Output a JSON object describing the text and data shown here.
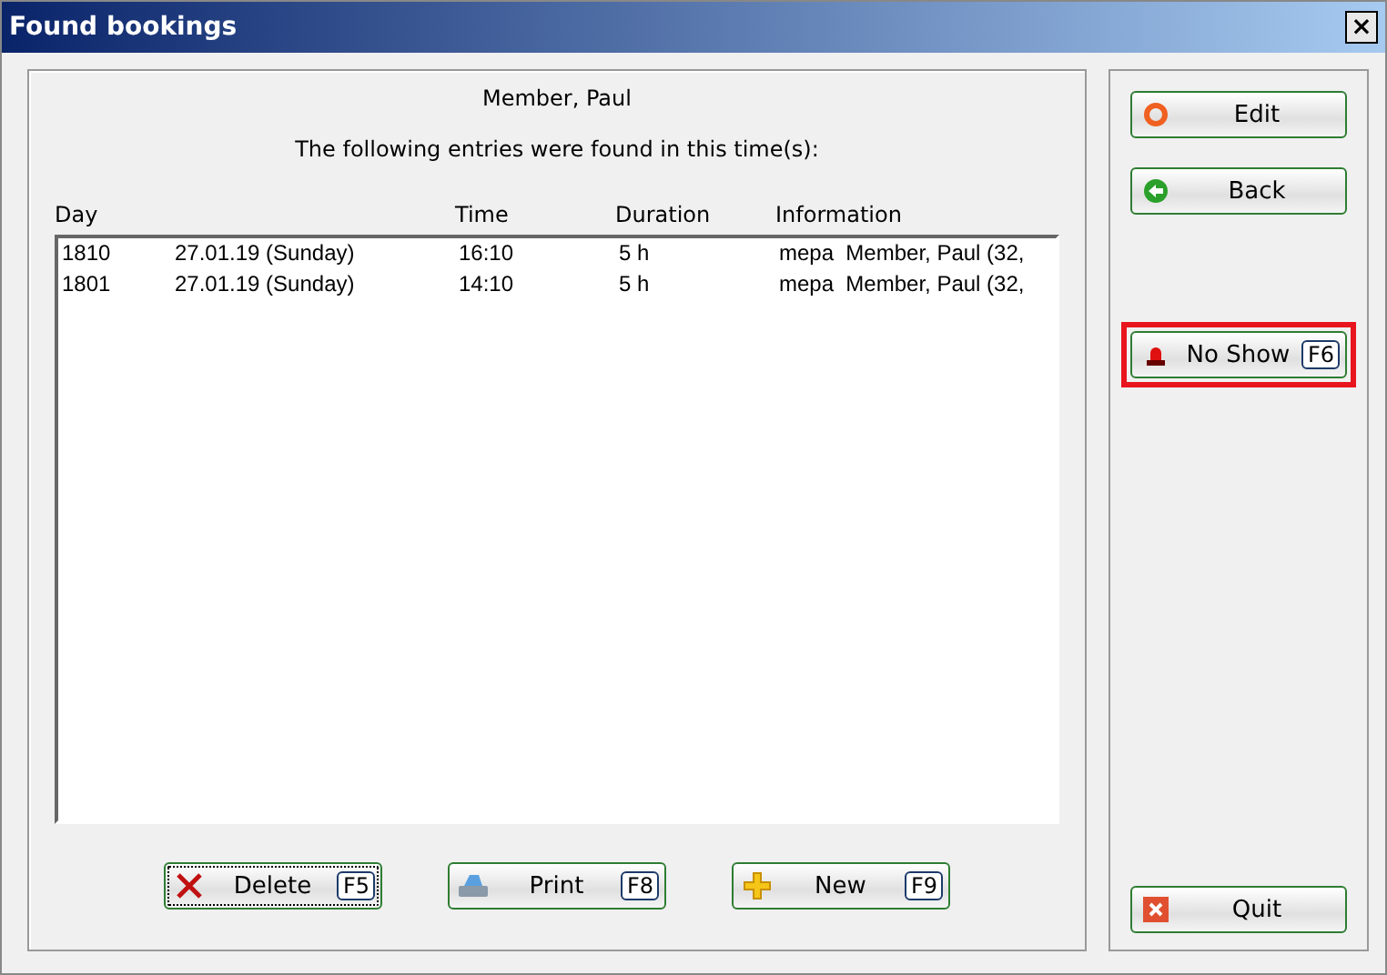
{
  "window": {
    "title": "Found bookings",
    "close": "×"
  },
  "header": {
    "name": "Member, Paul",
    "message": "The following entries were found in this time(s):"
  },
  "table": {
    "columns": [
      "Day",
      "",
      "Time",
      "Duration",
      "Information"
    ],
    "rows": [
      {
        "cells": [
          "1810",
          "27.01.19 (Sunday)",
          "16:10",
          "5 h",
          "mepa  Member, Paul (32,"
        ]
      },
      {
        "cells": [
          "1801",
          "27.01.19 (Sunday)",
          "14:10",
          "5 h",
          "mepa  Member, Paul (32,"
        ]
      }
    ]
  },
  "bottom_buttons": [
    {
      "label": "Delete",
      "key": "F5",
      "kind": "delete",
      "focused": true
    },
    {
      "label": "Print",
      "key": "F8",
      "kind": "print",
      "focused": false
    },
    {
      "label": "New",
      "key": "F9",
      "kind": "new",
      "focused": false
    }
  ],
  "side_buttons": [
    {
      "label": "Edit",
      "kind": "edit",
      "highlighted": false
    },
    {
      "label": "Back",
      "kind": "back",
      "highlighted": false
    },
    {
      "label": "No Show",
      "key": "F6",
      "kind": "noshow",
      "highlighted": true
    },
    {
      "label": "Quit",
      "kind": "quit",
      "highlighted": false
    }
  ]
}
